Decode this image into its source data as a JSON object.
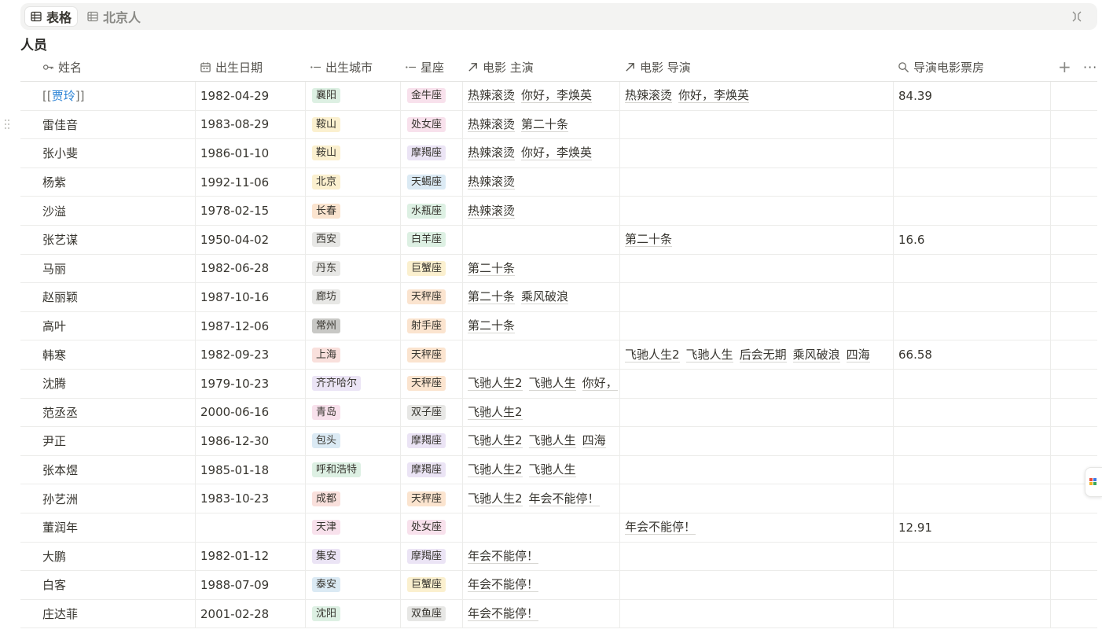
{
  "tabs": [
    {
      "label": "表格",
      "icon": "table-icon",
      "active": true
    },
    {
      "label": "北京人",
      "icon": "table-icon",
      "active": false
    }
  ],
  "database_title": "人员",
  "columns": [
    {
      "label": "姓名",
      "icon": "key-icon"
    },
    {
      "label": "出生日期",
      "icon": "calendar-icon"
    },
    {
      "label": "出生城市",
      "icon": "select-icon"
    },
    {
      "label": "星座",
      "icon": "select-icon"
    },
    {
      "label": "电影 主演",
      "icon": "relation-arrow-icon"
    },
    {
      "label": "电影 导演",
      "icon": "relation-arrow-icon"
    },
    {
      "label": "导演电影票房",
      "icon": "search-icon"
    }
  ],
  "add_column_label": "+",
  "more_label": "···",
  "colors": {
    "brown": "#f2e6d8",
    "orange": "#fbe4cf",
    "yellow": "#fbf0cf",
    "green": "#ddf0e3",
    "blue": "#dbeaf4",
    "purple": "#ebe4f5",
    "pink": "#f8e1ec",
    "red": "#f9e0dc",
    "gray": "#e7e7e5",
    "darkgray": "#c8c8c5"
  },
  "rows": [
    {
      "name": "贾玲",
      "name_link": true,
      "date": "1982-04-29",
      "city": {
        "label": "襄阳",
        "color": "green"
      },
      "zodiac": {
        "label": "金牛座",
        "color": "pink"
      },
      "starring": [
        "热辣滚烫",
        "你好，李焕英"
      ],
      "directing": [
        "热辣滚烫",
        "你好，李焕英"
      ],
      "box_office": "84.39"
    },
    {
      "name": "雷佳音",
      "date": "1983-08-29",
      "city": {
        "label": "鞍山",
        "color": "yellow"
      },
      "zodiac": {
        "label": "处女座",
        "color": "pink"
      },
      "starring": [
        "热辣滚烫",
        "第二十条"
      ],
      "directing": [],
      "box_office": ""
    },
    {
      "name": "张小斐",
      "date": "1986-01-10",
      "city": {
        "label": "鞍山",
        "color": "yellow"
      },
      "zodiac": {
        "label": "摩羯座",
        "color": "purple"
      },
      "starring": [
        "热辣滚烫",
        "你好，李焕英"
      ],
      "directing": [],
      "box_office": ""
    },
    {
      "name": "杨紫",
      "date": "1992-11-06",
      "city": {
        "label": "北京",
        "color": "yellow"
      },
      "zodiac": {
        "label": "天蝎座",
        "color": "blue"
      },
      "starring": [
        "热辣滚烫"
      ],
      "directing": [],
      "box_office": ""
    },
    {
      "name": "沙溢",
      "date": "1978-02-15",
      "city": {
        "label": "长春",
        "color": "orange"
      },
      "zodiac": {
        "label": "水瓶座",
        "color": "green"
      },
      "starring": [
        "热辣滚烫"
      ],
      "directing": [],
      "box_office": ""
    },
    {
      "name": "张艺谋",
      "date": "1950-04-02",
      "city": {
        "label": "西安",
        "color": "gray"
      },
      "zodiac": {
        "label": "白羊座",
        "color": "green"
      },
      "starring": [],
      "directing": [
        "第二十条"
      ],
      "box_office": "16.6"
    },
    {
      "name": "马丽",
      "date": "1982-06-28",
      "city": {
        "label": "丹东",
        "color": "gray"
      },
      "zodiac": {
        "label": "巨蟹座",
        "color": "yellow"
      },
      "starring": [
        "第二十条"
      ],
      "directing": [],
      "box_office": ""
    },
    {
      "name": "赵丽颖",
      "date": "1987-10-16",
      "city": {
        "label": "廊坊",
        "color": "gray"
      },
      "zodiac": {
        "label": "天秤座",
        "color": "orange"
      },
      "starring": [
        "第二十条",
        "乘风破浪"
      ],
      "directing": [],
      "box_office": ""
    },
    {
      "name": "高叶",
      "date": "1987-12-06",
      "city": {
        "label": "常州",
        "color": "darkgray"
      },
      "zodiac": {
        "label": "射手座",
        "color": "orange"
      },
      "starring": [
        "第二十条"
      ],
      "directing": [],
      "box_office": ""
    },
    {
      "name": "韩寒",
      "date": "1982-09-23",
      "city": {
        "label": "上海",
        "color": "red"
      },
      "zodiac": {
        "label": "天秤座",
        "color": "orange"
      },
      "starring": [],
      "directing": [
        "飞驰人生2",
        "飞驰人生",
        "后会无期",
        "乘风破浪",
        "四海"
      ],
      "box_office": "66.58"
    },
    {
      "name": "沈腾",
      "date": "1979-10-23",
      "city": {
        "label": "齐齐哈尔",
        "color": "purple"
      },
      "zodiac": {
        "label": "天秤座",
        "color": "orange"
      },
      "starring": [
        "飞驰人生2",
        "飞驰人生",
        "你好，"
      ],
      "directing": [],
      "box_office": ""
    },
    {
      "name": "范丞丞",
      "date": "2000-06-16",
      "city": {
        "label": "青岛",
        "color": "pink"
      },
      "zodiac": {
        "label": "双子座",
        "color": "gray"
      },
      "starring": [
        "飞驰人生2"
      ],
      "directing": [],
      "box_office": ""
    },
    {
      "name": "尹正",
      "date": "1986-12-30",
      "city": {
        "label": "包头",
        "color": "blue"
      },
      "zodiac": {
        "label": "摩羯座",
        "color": "purple"
      },
      "starring": [
        "飞驰人生2",
        "飞驰人生",
        "四海"
      ],
      "directing": [],
      "box_office": ""
    },
    {
      "name": "张本煜",
      "date": "1985-01-18",
      "city": {
        "label": "呼和浩特",
        "color": "green"
      },
      "zodiac": {
        "label": "摩羯座",
        "color": "purple"
      },
      "starring": [
        "飞驰人生2",
        "飞驰人生"
      ],
      "directing": [],
      "box_office": ""
    },
    {
      "name": "孙艺洲",
      "date": "1983-10-23",
      "city": {
        "label": "成都",
        "color": "red"
      },
      "zodiac": {
        "label": "天秤座",
        "color": "orange"
      },
      "starring": [
        "飞驰人生2",
        "年会不能停！"
      ],
      "directing": [],
      "box_office": ""
    },
    {
      "name": "董润年",
      "date": "",
      "city": {
        "label": "天津",
        "color": "pink"
      },
      "zodiac": {
        "label": "处女座",
        "color": "pink"
      },
      "starring": [],
      "directing": [
        "年会不能停！"
      ],
      "box_office": "12.91"
    },
    {
      "name": "大鹏",
      "date": "1982-01-12",
      "city": {
        "label": "集安",
        "color": "purple"
      },
      "zodiac": {
        "label": "摩羯座",
        "color": "purple"
      },
      "starring": [
        "年会不能停！"
      ],
      "directing": [],
      "box_office": ""
    },
    {
      "name": "白客",
      "date": "1988-07-09",
      "city": {
        "label": "泰安",
        "color": "blue"
      },
      "zodiac": {
        "label": "巨蟹座",
        "color": "yellow"
      },
      "starring": [
        "年会不能停！"
      ],
      "directing": [],
      "box_office": ""
    },
    {
      "name": "庄达菲",
      "date": "2001-02-28",
      "city": {
        "label": "沈阳",
        "color": "green"
      },
      "zodiac": {
        "label": "双鱼座",
        "color": "gray"
      },
      "starring": [
        "年会不能停！"
      ],
      "directing": [],
      "box_office": ""
    }
  ]
}
